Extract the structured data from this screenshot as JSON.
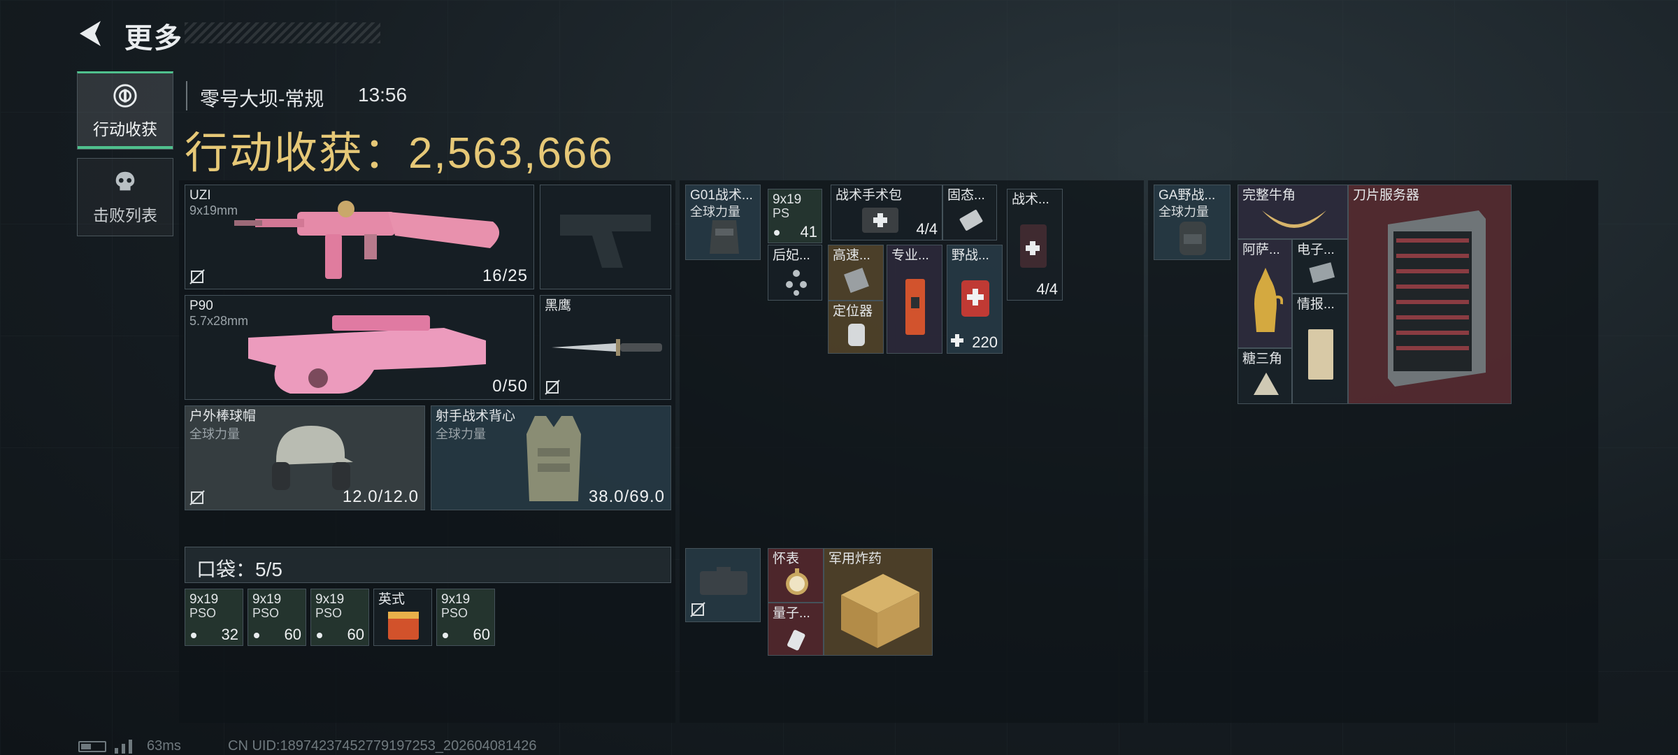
{
  "header": {
    "back_title": "更多"
  },
  "tabs": [
    {
      "label": "行动收获",
      "icon": "target-icon",
      "active": true
    },
    {
      "label": "击败列表",
      "icon": "skull-icon",
      "active": false
    }
  ],
  "info": {
    "map": "零号大坝-常规",
    "time": "13:56",
    "earnings_label": "行动收获：2,563,666"
  },
  "loadout": {
    "primary": {
      "name": "UZI",
      "ammo": "9x19mm",
      "count": "16/25"
    },
    "pistol": {
      "name": ""
    },
    "secondary": {
      "name": "P90",
      "ammo": "5.7x28mm",
      "count": "0/50"
    },
    "melee": {
      "name": "黑鹰"
    },
    "helmet": {
      "name": "户外棒球帽",
      "brand": "全球力量",
      "durability": "12.0/12.0"
    },
    "armor": {
      "name": "射手战术背心",
      "brand": "全球力量",
      "durability": "38.0/69.0"
    }
  },
  "pocket": {
    "label": "口袋：5/5",
    "items": [
      {
        "name": "9x19",
        "sub": "PSO",
        "count": "32"
      },
      {
        "name": "9x19",
        "sub": "PSO",
        "count": "60"
      },
      {
        "name": "9x19",
        "sub": "PSO",
        "count": "60"
      },
      {
        "name": "英式",
        "sub": "",
        "count": ""
      },
      {
        "name": "9x19",
        "sub": "PSO",
        "count": "60"
      }
    ]
  },
  "rig": {
    "name": "G01战术...",
    "brand": "全球力量",
    "items": {
      "ammo": {
        "name": "9x19",
        "sub": "PS",
        "count": "41"
      },
      "surgery": {
        "name": "战术手术包",
        "count": "4/4"
      },
      "fixed": {
        "name": "固态..."
      },
      "tactical": {
        "name": "战术...",
        "count": "4/4"
      },
      "houfei": {
        "name": "后妃..."
      },
      "gaosu": {
        "name": "高速..."
      },
      "zhuanye": {
        "name": "专业..."
      },
      "yezhan": {
        "name": "野战...",
        "count": "220"
      },
      "locator": {
        "name": "定位器"
      }
    }
  },
  "bag": {
    "name": "GA野战...",
    "brand": "全球力量",
    "items": {
      "horn": {
        "name": "完整牛角"
      },
      "server": {
        "name": "刀片服务器"
      },
      "asa": {
        "name": "阿萨..."
      },
      "dianzi": {
        "name": "电子..."
      },
      "qingbao": {
        "name": "情报..."
      },
      "tangsanjiao": {
        "name": "糖三角"
      }
    }
  },
  "safebox": {
    "items": {
      "watch": {
        "name": "怀表"
      },
      "explosive": {
        "name": "军用炸药"
      },
      "liangzi": {
        "name": "量子..."
      }
    }
  },
  "footer": {
    "ping": "63ms",
    "uid": "CN UID:18974237452779197253_202604081426"
  }
}
